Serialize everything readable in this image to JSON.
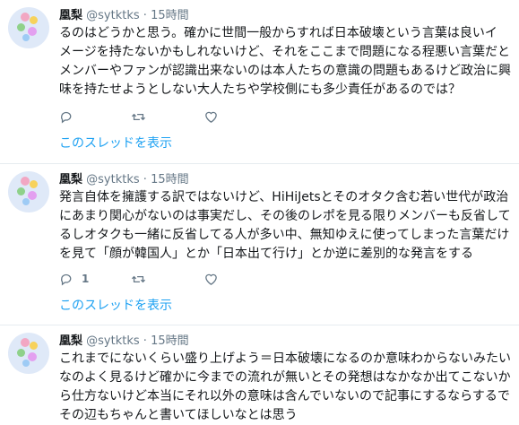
{
  "tweets": [
    {
      "name": "凰梨",
      "handle": "@sytktks",
      "dot": "·",
      "time": "15時間",
      "text": "るのはどうかと思う。確かに世間一般からすれば日本破壊という言葉は良いイ\nメージを持たないかもしれないけど、それをここまで問題になる程悪い言葉だと\nメンバーやファンが認識出来ないのは本人たちの意識の問題もあるけど政治に興\n味を持たせようとしない大人たちや学校側にも多少責任があるのでは？",
      "reply_count": "",
      "retweet_count": "",
      "like_count": "",
      "thread_link": "このスレッドを表示"
    },
    {
      "name": "凰梨",
      "handle": "@sytktks",
      "dot": "·",
      "time": "15時間",
      "text": "発言自体を擁護する訳ではないけど、HiHiJetsとそのオタク含む若い世代が政治\nにあまり関心がないのは事実だし、その後のレポを見る限りメンバーも反省して\nるしオタクも一緒に反省してる人が多い中、無知ゆえに使ってしまった言葉だけ\nを見て「顔が韓国人」とか「日本出て行け」とか逆に差別的な発言をする",
      "reply_count": "1",
      "retweet_count": "",
      "like_count": "",
      "thread_link": "このスレッドを表示"
    },
    {
      "name": "凰梨",
      "handle": "@sytktks",
      "dot": "·",
      "time": "15時間",
      "text": "これまでにないくらい盛り上げよう＝日本破壊になるのか意味わからないみたい\nなのよく見るけど確かに今までの流れが無いとその発想はなかなか出てこないか\nら仕方ないけど本当にそれ以外の意味は含んでいないので記事にするならするで\nその辺もちゃんと書いてほしいなとは思う"
    }
  ],
  "colors": {
    "link": "#1da1f2",
    "secondary_text": "#657786",
    "divider": "#e6ecf0"
  },
  "icons": [
    "reply-icon",
    "retweet-icon",
    "like-icon"
  ]
}
